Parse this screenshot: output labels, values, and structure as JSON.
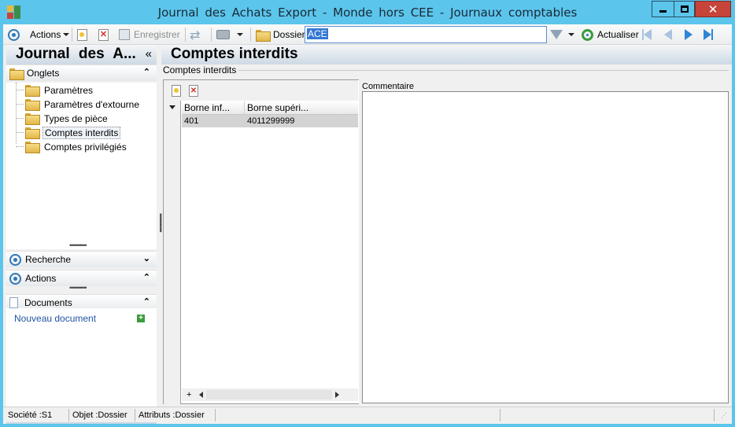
{
  "window": {
    "title": "Journal  des  Achats Export  -  Monde  hors CEE -  Journaux comptables",
    "icons": {
      "app": "app-icon",
      "minimize": "minimize-icon",
      "maximize": "maximize-icon",
      "close": "close-icon"
    }
  },
  "toolbar": {
    "actions_label": "Actions",
    "save_label": "Enregistrer",
    "dossier_label": "Dossier",
    "search_value": "ACE",
    "refresh_label": "Actualiser"
  },
  "left_panel": {
    "title": "Journal  des  A...",
    "collapse_glyph": "«",
    "tabs_section": {
      "label": "Onglets",
      "chevron": "⌃"
    },
    "tree_items": [
      {
        "label": "Paramètres"
      },
      {
        "label": "Paramètres d'extourne"
      },
      {
        "label": "Types de pièce"
      },
      {
        "label": "Comptes interdits",
        "selected": true
      },
      {
        "label": "Comptes privilégiés"
      }
    ],
    "search_section": {
      "label": "Recherche"
    },
    "actions_section": {
      "label": "Actions"
    },
    "documents_section": {
      "label": "Documents"
    },
    "new_document_label": "Nouveau document"
  },
  "main": {
    "title": "Comptes interdits",
    "group_label": "Comptes interdits",
    "grid": {
      "columns": [
        "Borne inf...",
        "Borne supéri..."
      ],
      "rows": [
        {
          "borne_inf": "401",
          "borne_sup": "4011299999"
        }
      ],
      "footer": "+"
    },
    "comment_label": "Commentaire"
  },
  "statusbar": {
    "societe": "Société :S1",
    "objet": "Objet :Dossier",
    "attributs": "Attributs :Dossier"
  },
  "colors": {
    "window_frame": "#5cc5ec",
    "accent_blue": "#2d78b8",
    "close_red": "#c7443a",
    "selection": "#3377d2"
  }
}
